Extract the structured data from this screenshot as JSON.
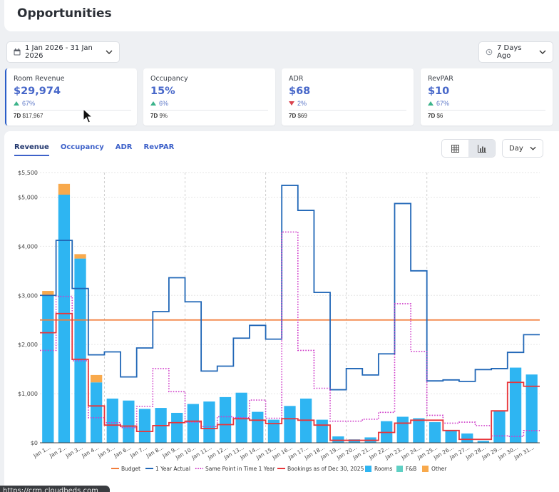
{
  "header": {
    "title": "Opportunities"
  },
  "controls": {
    "date_range": "1 Jan 2026 - 31 Jan 2026",
    "compare": "7 Days Ago"
  },
  "kpis": [
    {
      "label": "Room Revenue",
      "value": "$29,974",
      "change": "67%",
      "direction": "up",
      "prev_label": "7D",
      "prev_value": "$17,967"
    },
    {
      "label": "Occupancy",
      "value": "15%",
      "change": "6%",
      "direction": "up",
      "prev_label": "7D",
      "prev_value": "9%"
    },
    {
      "label": "ADR",
      "value": "$68",
      "change": "2%",
      "direction": "down",
      "prev_label": "7D",
      "prev_value": "$69"
    },
    {
      "label": "RevPAR",
      "value": "$10",
      "change": "67%",
      "direction": "up",
      "prev_label": "7D",
      "prev_value": "$6"
    }
  ],
  "tabs": [
    {
      "label": "Revenue",
      "active": true
    },
    {
      "label": "Occupancy",
      "active": false
    },
    {
      "label": "ADR",
      "active": false
    },
    {
      "label": "RevPAR",
      "active": false
    }
  ],
  "granularity": "Day",
  "status_url": "https://crm.cloudbeds.com",
  "colors": {
    "accent": "#3d61c9",
    "rooms": "#2eb5f2",
    "fnb": "#5fd0c4",
    "other": "#f8a94c",
    "budget": "#f27d3b",
    "one_year_actual": "#2167b7",
    "same_point": "#cf3cc9",
    "bookings": "#e8353a"
  },
  "chart_data": {
    "type": "bar",
    "categories": [
      "Jan 1...",
      "Jan 2...",
      "Jan 3...",
      "Jan 4...",
      "Jan 5...",
      "Jan 6...",
      "Jan 7...",
      "Jan 8...",
      "Jan 9...",
      "Jan 10...",
      "Jan 11...",
      "Jan 12...",
      "Jan 13...",
      "Jan 14...",
      "Jan 15...",
      "Jan 16...",
      "Jan 17...",
      "Jan 18...",
      "Jan 19...",
      "Jan 20...",
      "Jan 21...",
      "Jan 22...",
      "Jan 23...",
      "Jan 24...",
      "Jan 25...",
      "Jan 26...",
      "Jan 27...",
      "Jan 28...",
      "Jan 29...",
      "Jan 30...",
      "Jan 31..."
    ],
    "ylim": [
      0,
      5500
    ],
    "yticks": [
      0,
      1000,
      2000,
      3000,
      4000,
      5000,
      5500
    ],
    "ytick_labels": [
      "$0",
      "$1,000",
      "$2,000",
      "$3,000",
      "$4,000",
      "$5,000",
      "$5,500"
    ],
    "stacks": [
      {
        "name": "Rooms",
        "values": [
          3000,
          5050,
          3750,
          1230,
          900,
          860,
          690,
          710,
          610,
          790,
          840,
          930,
          1020,
          630,
          470,
          750,
          900,
          470,
          130,
          70,
          110,
          440,
          530,
          500,
          420,
          240,
          190,
          40,
          640,
          1530,
          1390
        ]
      },
      {
        "name": "F&B",
        "values": [
          0,
          0,
          0,
          0,
          0,
          0,
          0,
          0,
          0,
          0,
          0,
          0,
          0,
          0,
          0,
          0,
          0,
          0,
          0,
          0,
          0,
          0,
          0,
          0,
          0,
          0,
          0,
          0,
          0,
          0,
          0
        ]
      },
      {
        "name": "Other",
        "values": [
          90,
          220,
          90,
          150,
          0,
          0,
          0,
          0,
          0,
          0,
          0,
          0,
          0,
          0,
          0,
          0,
          0,
          0,
          0,
          0,
          0,
          0,
          0,
          0,
          0,
          0,
          0,
          0,
          0,
          0,
          0
        ]
      }
    ],
    "lines": [
      {
        "name": "Budget",
        "style": "solid",
        "values": [
          2500,
          2500,
          2500,
          2500,
          2500,
          2500,
          2500,
          2500,
          2500,
          2500,
          2500,
          2500,
          2500,
          2500,
          2500,
          2500,
          2500,
          2500,
          2500,
          2500,
          2500,
          2500,
          2500,
          2500,
          2500,
          2500,
          2500,
          2500,
          2500,
          2500,
          2500
        ]
      },
      {
        "name": "1 Year Actual",
        "style": "step",
        "values": [
          3000,
          4120,
          3140,
          1790,
          1850,
          1340,
          1930,
          2670,
          3360,
          2870,
          1460,
          1560,
          2130,
          2390,
          2110,
          5240,
          4730,
          3060,
          1080,
          1510,
          1380,
          1810,
          4870,
          3500,
          1260,
          1280,
          1250,
          1490,
          1510,
          1840,
          2200
        ]
      },
      {
        "name": "Same Point in Time 1 Year",
        "style": "dotted",
        "values": [
          1880,
          2980,
          1670,
          510,
          410,
          310,
          740,
          1510,
          1040,
          420,
          330,
          530,
          510,
          870,
          500,
          4290,
          1880,
          1110,
          440,
          440,
          480,
          620,
          2830,
          1860,
          560,
          400,
          420,
          350,
          140,
          130,
          250
        ]
      },
      {
        "name": "Bookings as of Dec 30, 2025",
        "style": "step",
        "values": [
          2240,
          2630,
          1700,
          750,
          360,
          340,
          230,
          350,
          410,
          440,
          290,
          370,
          490,
          460,
          390,
          490,
          460,
          360,
          50,
          50,
          50,
          210,
          400,
          460,
          460,
          250,
          70,
          70,
          650,
          1230,
          1150
        ]
      }
    ],
    "legend": [
      {
        "name": "Budget",
        "kind": "line",
        "color": "#f27d3b"
      },
      {
        "name": "1 Year Actual",
        "kind": "line",
        "color": "#2167b7"
      },
      {
        "name": "Same Point in Time 1 Year",
        "kind": "dotted",
        "color": "#cf3cc9"
      },
      {
        "name": "Bookings as of Dec 30, 2025",
        "kind": "line",
        "color": "#e8353a"
      },
      {
        "name": "Rooms",
        "kind": "box",
        "color": "#2eb5f2"
      },
      {
        "name": "F&B",
        "kind": "box",
        "color": "#5fd0c4"
      },
      {
        "name": "Other",
        "kind": "box",
        "color": "#f8a94c"
      }
    ],
    "legend_position": "bottom",
    "grid": true
  }
}
